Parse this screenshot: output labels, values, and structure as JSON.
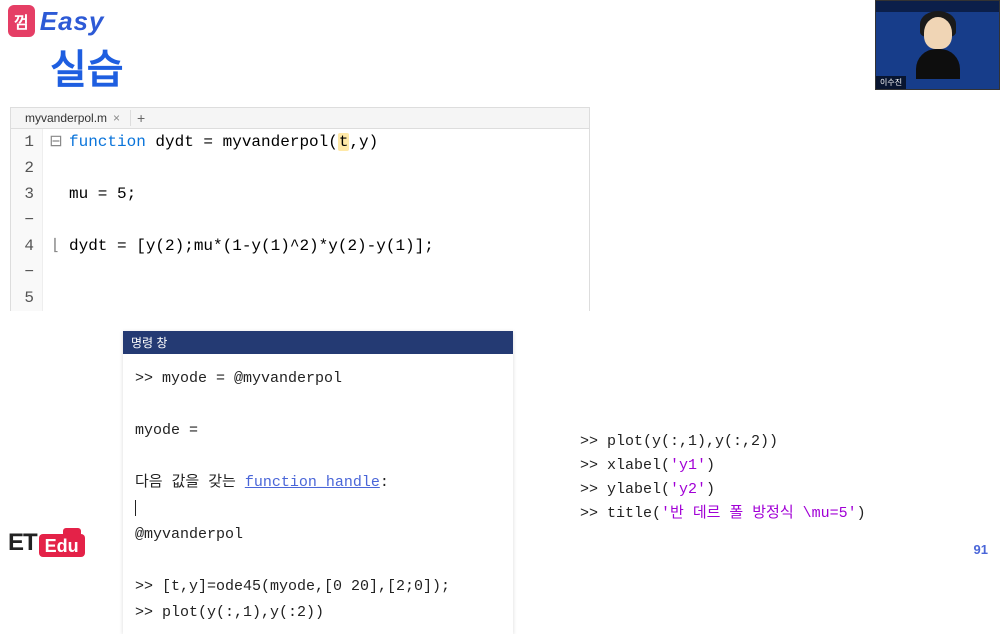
{
  "header": {
    "logo_badge": "껌",
    "easy_text": "Easy"
  },
  "title": "실습",
  "webcam": {
    "name_label": "이수진"
  },
  "editor": {
    "tab_name": "myvanderpol.m",
    "lines": [
      {
        "num": "1",
        "mark": "",
        "bracket": "⊟"
      },
      {
        "num": "2",
        "mark": "",
        "bracket": ""
      },
      {
        "num": "3",
        "mark": "−",
        "bracket": ""
      },
      {
        "num": "4",
        "mark": "−",
        "bracket": "⌊"
      },
      {
        "num": "5",
        "mark": "",
        "bracket": ""
      }
    ],
    "code": {
      "l1_kw": "function",
      "l1_pre": " dydt = myvanderpol(",
      "l1_hl": "t",
      "l1_post": ",y)",
      "l3": "mu = 5;",
      "l4": "dydt = [y(2);mu*(1-y(1)^2)*y(2)-y(1)];"
    }
  },
  "terminal": {
    "header": "명령 창",
    "l1": ">> myode = @myvanderpol",
    "l2": "myode =",
    "l3_pre": "  다음 값을 갖는 ",
    "l3_link": "function_handle",
    "l3_post": ":",
    "l4": "    @myvanderpol",
    "l5": ">> [t,y]=ode45(myode,[0 20],[2;0]);",
    "l6": ">> plot(y(:,1),y(:2))"
  },
  "right": {
    "r1": ">> plot(y(:,1),y(:,2))",
    "r2_pre": ">> xlabel(",
    "r2_str": "'y1'",
    "r2_post": ")",
    "r3_pre": ">> ylabel(",
    "r3_str": "'y2'",
    "r3_post": ")",
    "r4_pre": ">> title(",
    "r4_str": "'반 데르 폴 방정식 \\mu=5'",
    "r4_post": ")"
  },
  "footer": {
    "et": "ET",
    "edu": "Edu",
    "page": "91"
  }
}
